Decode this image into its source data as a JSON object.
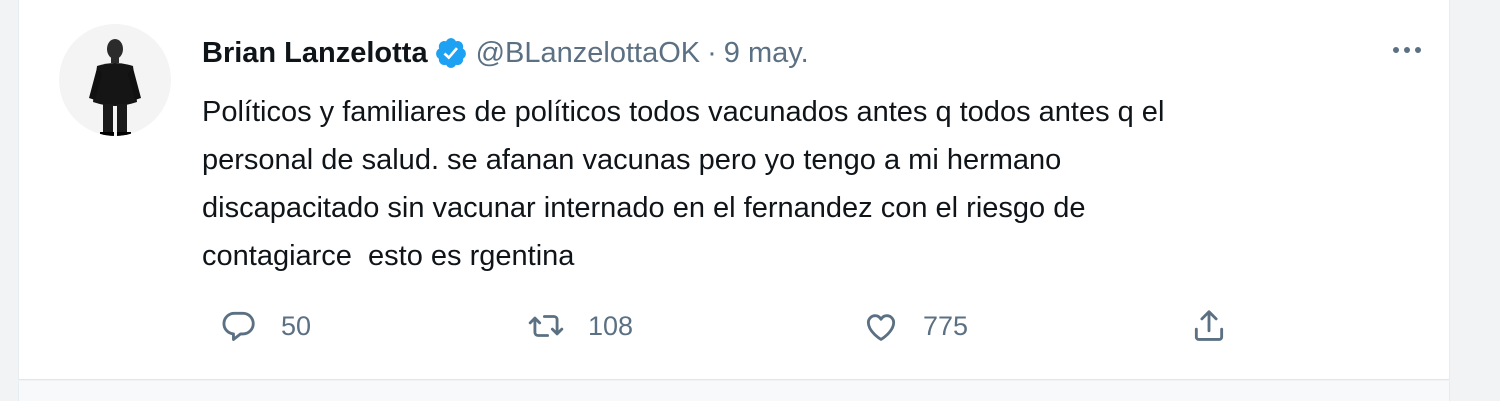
{
  "tweet": {
    "author": {
      "display_name": "Brian Lanzelotta",
      "verified": true,
      "handle": "@BLanzelottaOK"
    },
    "separator": "·",
    "date": "9 may.",
    "text_lines": [
      "Políticos y familiares de políticos todos vacunados antes q todos antes q el",
      "personal de salud. se afanan vacunas pero yo tengo a mi hermano",
      "discapacitado sin vacunar internado en el fernandez con el riesgo de",
      "contagiarce  esto es rgentina"
    ],
    "actions": {
      "replies": "50",
      "retweets": "108",
      "likes": "775"
    }
  },
  "icons": {
    "verified": "verified-badge-icon",
    "more": "more-icon",
    "reply": "reply-icon",
    "retweet": "retweet-icon",
    "like": "like-icon",
    "share": "share-icon"
  },
  "colors": {
    "verified_blue": "#1da1f2",
    "secondary_text": "#5b7083",
    "primary_text": "#0f1419",
    "card_background": "#ffffff"
  }
}
